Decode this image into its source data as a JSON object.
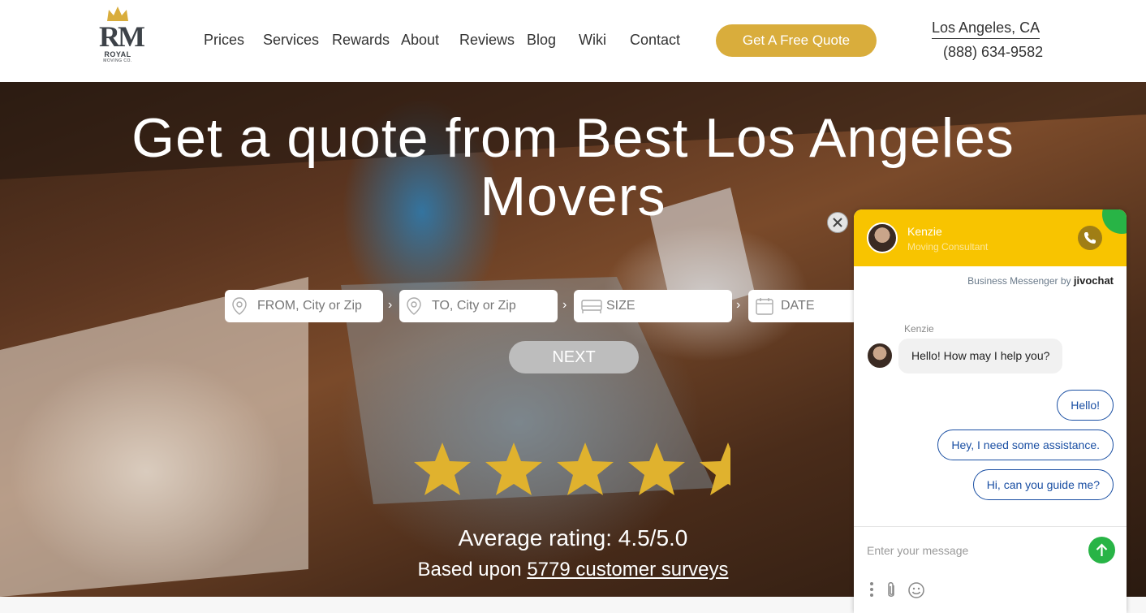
{
  "header": {
    "logo": {
      "monogram": "RM",
      "brand": "ROYAL",
      "sub": "MOVING CO."
    },
    "nav": [
      "Prices",
      "Services",
      "Rewards",
      "About",
      "Reviews",
      "Blog",
      "Wiki",
      "Contact"
    ],
    "quote_button": "Get A Free Quote",
    "city": "Los Angeles, CA",
    "phone": "(888) 634-9582"
  },
  "hero": {
    "title_line1": "Get a quote from Best Los Angeles",
    "title_line2": "Movers",
    "form": {
      "from_placeholder": "FROM, City or Zip",
      "to_placeholder": "TO, City or Zip",
      "size_placeholder": "SIZE",
      "date_placeholder": "DATE",
      "separator": "›",
      "next_button": "NEXT"
    },
    "rating_stars": 4.5,
    "rating_text": "Average rating: 4.5/5.0",
    "surveys_prefix": "Based upon ",
    "surveys_link": "5779 customer surveys"
  },
  "chat": {
    "close_symbol": "✕",
    "agent_name": "Kenzie",
    "agent_role": "Moving Consultant",
    "powered_prefix": "Business Messenger by",
    "powered_brand": "jivochat",
    "message_sender": "Kenzie",
    "message_text": "Hello! How may I help you?",
    "quick_replies": [
      "Hello!",
      "Hey, I need some assistance.",
      "Hi, can you guide me?"
    ],
    "input_placeholder": "Enter your message",
    "colors": {
      "header": "#f8c400",
      "send": "#28b446",
      "reply_border": "#1a4fa3"
    }
  },
  "colors": {
    "accent_gold": "#d9ad3c",
    "star": "#e0b22e"
  }
}
